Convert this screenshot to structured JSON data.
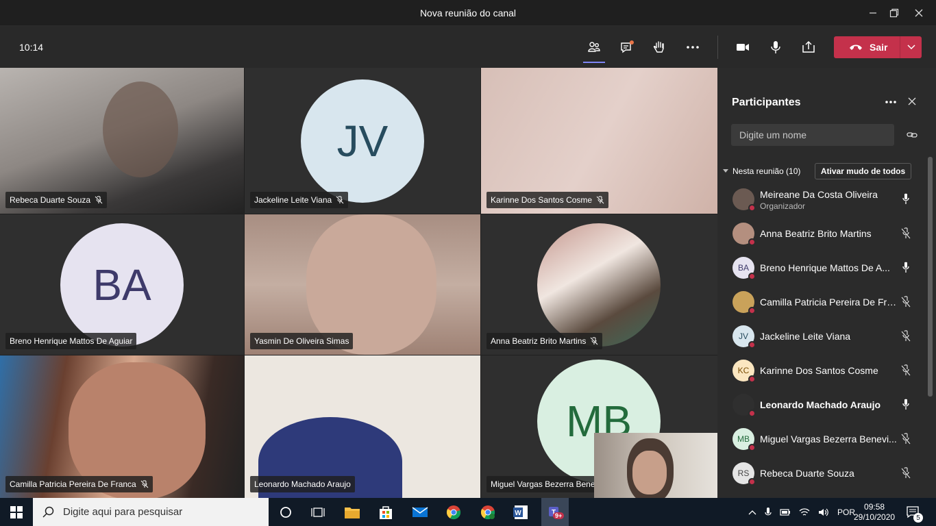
{
  "window": {
    "title": "Nova reunião do canal"
  },
  "toolbar": {
    "time": "10:14",
    "leave_label": "Sair"
  },
  "tiles": [
    {
      "name": "Rebeca Duarte Souza",
      "type": "video",
      "color": "#8f8a87"
    },
    {
      "name": "Jackeline Leite Viana",
      "type": "avatar",
      "initials": "JV",
      "bg": "#d8e6ee",
      "fg": "#274c5e"
    },
    {
      "name": "Karinne Dos Santos Cosme",
      "type": "video",
      "color": "#d9c0b9"
    },
    {
      "name": "Breno Henrique Mattos De Aguiar",
      "type": "avatar",
      "initials": "BA",
      "bg": "#e6e3f0",
      "fg": "#3e3a6a"
    },
    {
      "name": "Yasmin De Oliveira Simas",
      "type": "video",
      "color": "#b59a8b"
    },
    {
      "name": "Anna Beatriz Brito Martins",
      "type": "photo",
      "color": "#c9a89c"
    },
    {
      "name": "Camilla Patricia Pereira De Franca",
      "type": "video",
      "color": "#6e4a3a"
    },
    {
      "name": "Leonardo Machado Araujo",
      "type": "video",
      "color": "#e8e2da"
    },
    {
      "name": "Miguel Vargas Bezerra Benev",
      "type": "avatar",
      "initials": "MB",
      "bg": "#d9efe1",
      "fg": "#236b3c"
    }
  ],
  "panel": {
    "title": "Participantes",
    "search_placeholder": "Digite um nome",
    "section_label": "Nesta reunião (10)",
    "mute_all_label": "Ativar mudo de todos",
    "participants": [
      {
        "name": "Meireane Da Costa Oliveira",
        "role": "Organizador",
        "initials": "",
        "bg": "#6b5a52",
        "fg": "#fff",
        "mic": "on"
      },
      {
        "name": "Anna Beatriz Brito Martins",
        "role": "",
        "initials": "",
        "bg": "#b48f7f",
        "fg": "#fff",
        "mic": "off"
      },
      {
        "name": "Breno Henrique Mattos De A...",
        "role": "",
        "initials": "BA",
        "bg": "#e6e3f0",
        "fg": "#3e3a6a",
        "mic": "on"
      },
      {
        "name": "Camilla Patricia Pereira De Fra...",
        "role": "",
        "initials": "",
        "bg": "#c9a25a",
        "fg": "#fff",
        "mic": "off"
      },
      {
        "name": "Jackeline Leite Viana",
        "role": "",
        "initials": "JV",
        "bg": "#d8e6ee",
        "fg": "#274c5e",
        "mic": "off"
      },
      {
        "name": "Karinne Dos Santos Cosme",
        "role": "",
        "initials": "KC",
        "bg": "#fbe6c0",
        "fg": "#7a4d05",
        "mic": "off"
      },
      {
        "name": "Leonardo Machado Araujo",
        "role": "",
        "initials": "",
        "bg": "#2f2f2f",
        "fg": "#fff",
        "mic": "on",
        "bold": true
      },
      {
        "name": "Miguel Vargas Bezerra Benevi...",
        "role": "",
        "initials": "MB",
        "bg": "#d9efe1",
        "fg": "#236b3c",
        "mic": "off"
      },
      {
        "name": "Rebeca Duarte Souza",
        "role": "",
        "initials": "RS",
        "bg": "#e5e5e5",
        "fg": "#444",
        "mic": "off"
      }
    ]
  },
  "taskbar": {
    "search_placeholder": "Digite aqui para pesquisar",
    "teams_badge": "9+",
    "language": "POR",
    "time": "09:58",
    "date": "29/10/2020",
    "notifications": "5"
  }
}
